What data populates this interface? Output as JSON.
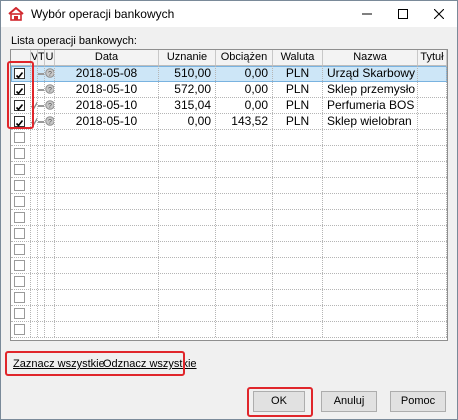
{
  "window": {
    "title": "Wybór operacji bankowych"
  },
  "list_label": "Lista operacji bankowych:",
  "columns": [
    "",
    "V",
    "T",
    "U",
    "Data",
    "Uznanie",
    "Obciążen",
    "Waluta",
    "Nazwa",
    "Tytuł"
  ],
  "rows": [
    {
      "checked": true,
      "v": false,
      "date": "2018-05-08",
      "uznanie": "510,00",
      "obciazenie": "0,00",
      "waluta": "PLN",
      "nazwa": "Urząd Skarbowy",
      "tytul": "",
      "selected": true
    },
    {
      "checked": true,
      "v": false,
      "date": "2018-05-10",
      "uznanie": "572,00",
      "obciazenie": "0,00",
      "waluta": "PLN",
      "nazwa": "Sklep przemysło",
      "tytul": "",
      "selected": false
    },
    {
      "checked": true,
      "v": true,
      "date": "2018-05-10",
      "uznanie": "315,04",
      "obciazenie": "0,00",
      "waluta": "PLN",
      "nazwa": "Perfumeria BOS",
      "tytul": "",
      "selected": false
    },
    {
      "checked": true,
      "v": true,
      "date": "2018-05-10",
      "uznanie": "0,00",
      "obciazenie": "143,52",
      "waluta": "PLN",
      "nazwa": "Sklep wielobran",
      "tytul": "",
      "selected": false
    }
  ],
  "empty_rows": 13,
  "links": {
    "select_all": "Zaznacz wszystkie",
    "deselect_all": "Odznacz wszystkie"
  },
  "buttons": {
    "ok": "OK",
    "cancel": "Anuluj",
    "help": "Pomoc"
  },
  "colors": {
    "highlight": "#e0262b",
    "selection": "#cde6f7"
  }
}
